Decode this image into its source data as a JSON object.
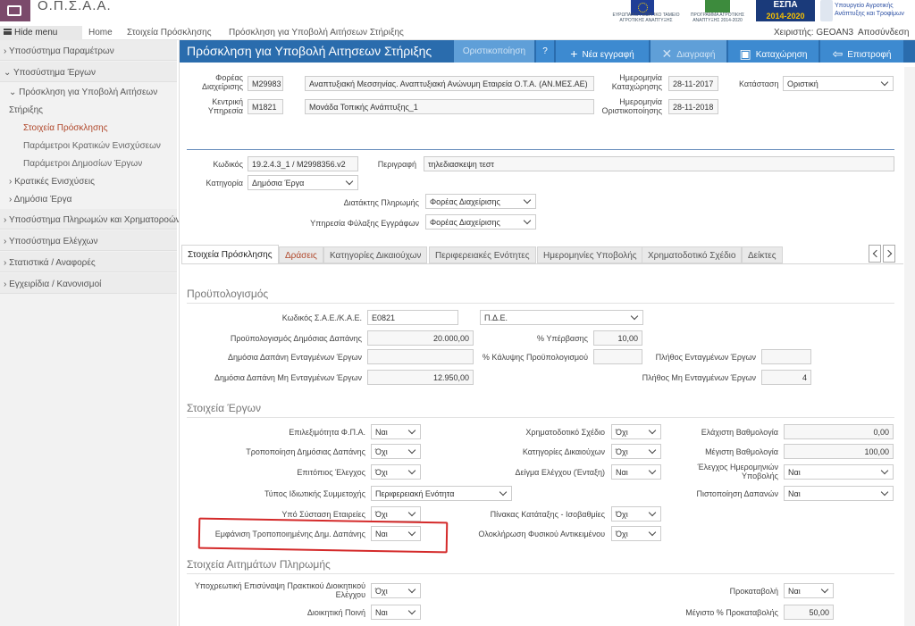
{
  "app": {
    "title": "Ο.Π.Σ.Α.Α."
  },
  "logos": {
    "eu_text": "ΕΥΡΩΠΑΪΚΟ ΓΕΩΡΓΙΚΟ ΤΑΜΕΙΟ ΑΓΡΟΤΙΚΗΣ ΑΝΑΠΤΥΞΗΣ",
    "agri_text": "ΠΡΟΓΡΑΜΜΑ ΑΓΡΟΤΙΚΗΣ ΑΝΑΠΤΥΞΗΣ 2014-2020",
    "espa_title": "ΕΣΠΑ",
    "espa_years": "2014-2020",
    "gov_text": "Υπουργείο Αγροτικής Ανάπτυξης και Τροφίμων"
  },
  "nav": {
    "hide_menu": "Hide menu",
    "home": "Home",
    "crumb1": "Στοιχεία Πρόσκλησης",
    "crumb2": "Πρόσκληση για Υποβολή Αιτήσεων Στήριξης",
    "user": "Χειριστής: GEOAN3",
    "logout": "Αποσύνδεση"
  },
  "sidebar": {
    "items": [
      {
        "label": "Υποσύστημα Παραμέτρων"
      },
      {
        "label": "Υποσύστημα Έργων"
      },
      {
        "label": "Πρόσκληση για Υποβολή Αιτήσεων"
      },
      {
        "label": "Στήριξης"
      },
      {
        "label": "Στοιχεία Πρόσκλησης"
      },
      {
        "label": "Παράμετροι Κρατικών Ενισχύσεων"
      },
      {
        "label": "Παράμετροι Δημοσίων Έργων"
      },
      {
        "label": "Κρατικές Ενισχύσεις"
      },
      {
        "label": "Δημόσια Έργα"
      },
      {
        "label": "Υποσύστημα Πληρωμών και Χρηματοροών"
      },
      {
        "label": "Υποσύστημα Ελέγχων"
      },
      {
        "label": "Στατιστικά / Αναφορές"
      },
      {
        "label": "Εγχειρίδια / Κανονισμοί"
      }
    ]
  },
  "header": {
    "title": "Πρόσκληση για Υποβολή Αιτησεων Στήριξης",
    "finalize": "Οριστικοποίηση",
    "help": "?",
    "new": "Νέα εγγραφή",
    "delete": "Διαγραφή",
    "save": "Καταχώρηση",
    "back": "Επιστροφή"
  },
  "form": {
    "agency_label1": "Φορέας",
    "agency_label2": "Διαχείρισης",
    "agency_code": "M29983",
    "agency_name": "Αναπτυξιακή Μεσσηνίας. Αναπτυξιακή Ανώνυμη Εταιρεία Ο.Τ.Α. (ΑΝ.ΜΕΣ.ΑΕ)",
    "service_label1": "Κεντρική",
    "service_label2": "Υπηρεσία",
    "service_code": "M1821",
    "service_name": "Μονάδα Τοπικής Ανάπτυξης_1",
    "reg_date_label1": "Ημερομηνία",
    "reg_date_label2": "Καταχώρησης",
    "reg_date": "28-11-2017",
    "final_date_label1": "Ημερομηνία",
    "final_date_label2": "Οριστικοποίησης",
    "final_date": "28-11-2018",
    "status_label": "Κατάσταση",
    "status": "Οριστική",
    "code_label": "Κωδικός",
    "code": "19.2.4.3_1 / M2998356.v2",
    "desc_label": "Περιγραφή",
    "desc": "τηλεδιασκεψη τεστ",
    "category_label": "Κατηγορία",
    "category": "Δημόσια Έργα",
    "payer_label": "Διατάκτης Πληρωμής",
    "payer": "Φορέας Διαχείρισης",
    "archive_label": "Υπηρεσία Φύλαξης Εγγράφων",
    "archive": "Φορέας Διαχείρισης"
  },
  "tabs": [
    "Στοιχεία Πρόσκλησης",
    "Δράσεις",
    "Κατηγορίες Δικαιούχων",
    "Περιφερειακές Ενότητες",
    "Ημερομηνίες Υποβολής",
    "Χρηματοδοτικό Σχέδιο",
    "Δείκτες"
  ],
  "budget": {
    "title": "Προϋπολογισμός",
    "sae_label": "Κωδικός Σ.Α.Ε./Κ.Α.Ε.",
    "sae": "Ε0821",
    "pde": "Π.Δ.Ε.",
    "public_label": "Προϋπολογισμός Δημόσιας Δαπάνης",
    "public": "20.000,00",
    "over_label": "% Υπέρβασης",
    "over": "10,00",
    "included_label": "Δημόσια Δαπάνη Ενταγμένων Έργων",
    "included": "",
    "coverage_label": "% Κάλυψης Προϋπολογισμού",
    "coverage": "",
    "count_included_label": "Πλήθος Ενταγμένων Έργων",
    "count_included": "",
    "not_included_label": "Δημόσια Δαπάνη Μη Ενταγμένων Έργων",
    "not_included": "12.950,00",
    "count_not_included_label": "Πλήθος Μη Ενταγμένων Έργων",
    "count_not_included": "4"
  },
  "projects": {
    "title": "Στοιχεία Έργων",
    "vat_label": "Επιλεξιμότητα Φ.Π.Α.",
    "vat": "Ναι",
    "funding_label": "Χρηματοδοτικό Σχέδιο",
    "funding": "Όχι",
    "min_score_label": "Ελάχιστη Βαθμολογία",
    "min_score": "0,00",
    "modify_label": "Τροποποίηση Δημόσιας Δαπάνης",
    "modify": "Όχι",
    "benef_label": "Κατηγορίες Δικαιούχων",
    "benef": "Όχι",
    "max_score_label": "Μέγιστη Βαθμολογία",
    "max_score": "100,00",
    "onsite_label": "Επιτόπιος Έλεγχος",
    "onsite": "Όχι",
    "sample_label": "Δείγμα Ελέγχου (Ένταξη)",
    "sample": "Ναι",
    "date_check_label1": "Έλεγχος Ημερομηνιών",
    "date_check_label2": "Υποβολής",
    "date_check": "Ναι",
    "ownership_label": "Τύπος Ιδιωτικής Συμμετοχής",
    "ownership": "Περιφερειακή Ενότητα",
    "cert_label": "Πιστοποίηση Δαπανών",
    "cert": "Ναι",
    "company_label": "Υπό Σύσταση Εταιρείες",
    "company": "Όχι",
    "ranking_label": "Πίνακας Κατάταξης - Ισοβαθμίες",
    "ranking": "Όχι",
    "show_mod_label": "Εμφάνιση Τροποποιημένης Δημ. Δαπάνης",
    "show_mod": "Ναι",
    "complete_label": "Ολοκλήρωση Φυσικού Αντικειμένου",
    "complete": "Όχι"
  },
  "payments": {
    "title": "Στοιχεία Αιτημάτων Πληρωμής",
    "mandatory_label1": "Υποχρεωτική Επισύναψη Πρακτικού Διοικητικού",
    "mandatory_label2": "Ελέγχου",
    "mandatory": "Όχι",
    "advance_label": "Προκαταβολή",
    "advance": "Ναι",
    "penalty_label": "Διοικητική Ποινή",
    "penalty": "Ναι",
    "max_adv_label": "Μέγιστο % Προκαταβολής",
    "max_adv": "50,00"
  }
}
